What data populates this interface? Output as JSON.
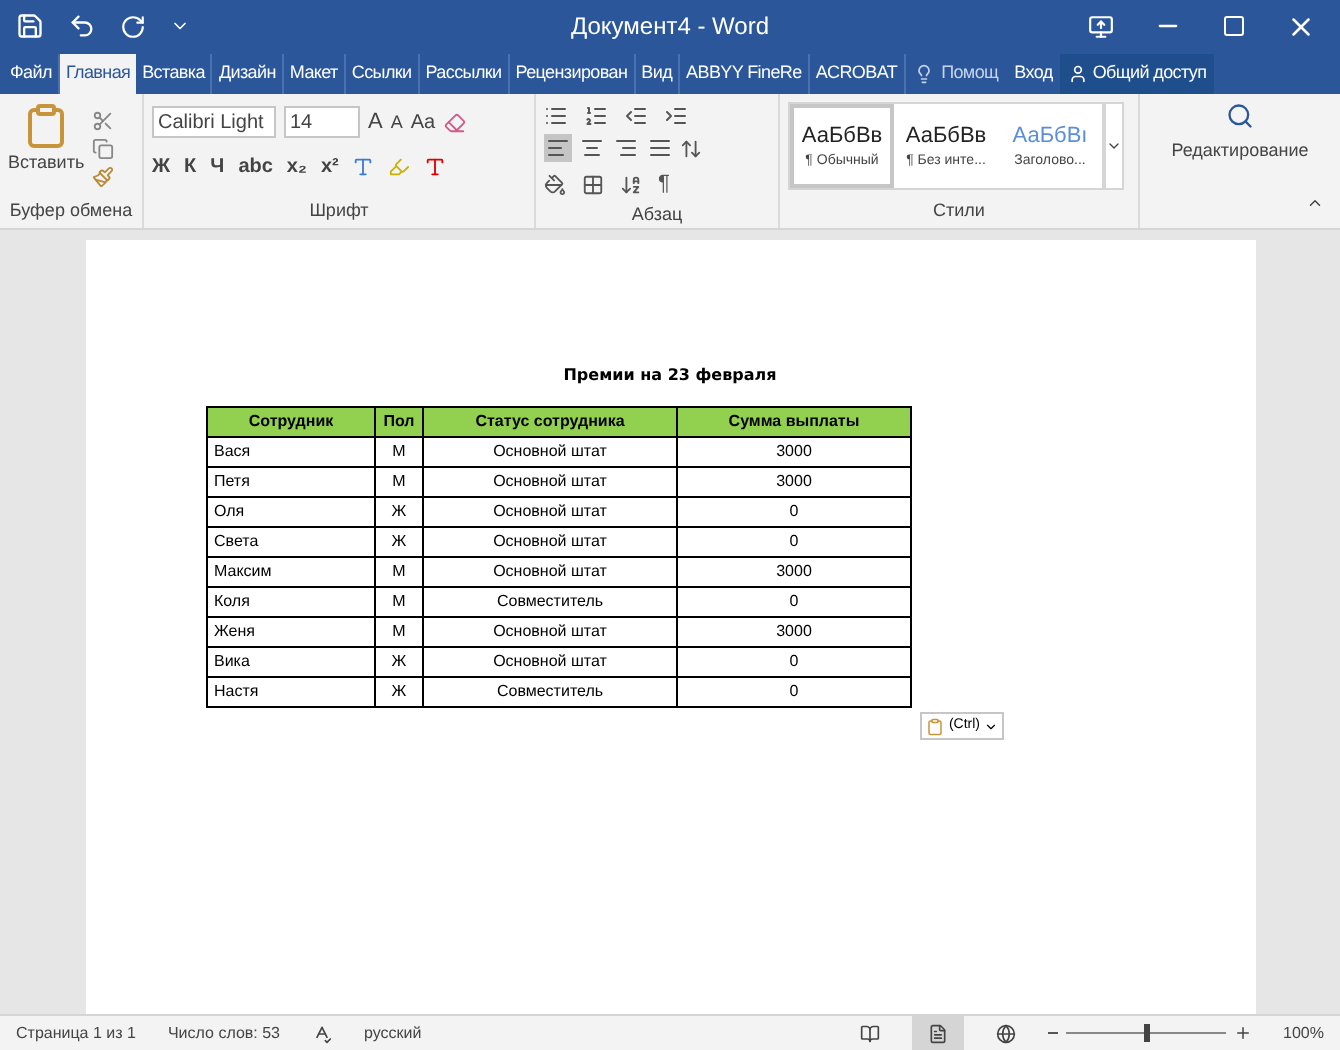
{
  "window": {
    "title": "Документ4 - Word"
  },
  "tabs": [
    {
      "label": "Файл",
      "selected": false
    },
    {
      "label": "Главная",
      "selected": true
    },
    {
      "label": "Вставка",
      "selected": false
    },
    {
      "label": "Дизайн",
      "selected": false
    },
    {
      "label": "Макет",
      "selected": false
    },
    {
      "label": "Ссылки",
      "selected": false
    },
    {
      "label": "Рассылки",
      "selected": false
    },
    {
      "label": "Рецензирован",
      "selected": false
    },
    {
      "label": "Вид",
      "selected": false
    },
    {
      "label": "ABBYY FineRe",
      "selected": false
    },
    {
      "label": "ACROBAT",
      "selected": false
    }
  ],
  "tell_me": "Помощ",
  "sign_in": "Вход",
  "share": "Общий доступ",
  "ribbon": {
    "clipboard": {
      "paste": "Вставить",
      "label": "Буфер обмена"
    },
    "font": {
      "name": "Calibri Light",
      "size": "14",
      "grow": "A",
      "shrink": "A",
      "case": "Aa",
      "styles": [
        "Ж",
        "К",
        "Ч",
        "abc",
        "x₂",
        "x²"
      ],
      "label": "Шрифт"
    },
    "paragraph": {
      "label": "Абзац",
      "align": [
        {
          "kind": "left",
          "selected": true
        },
        {
          "kind": "center",
          "selected": false
        },
        {
          "kind": "right",
          "selected": false
        },
        {
          "kind": "justify",
          "selected": false
        }
      ],
      "pilcrow": "¶"
    },
    "styles": {
      "label": "Стили",
      "items": [
        {
          "sample": "АаБбВв",
          "name": "¶ Обычный",
          "selected": true,
          "kind": "normal"
        },
        {
          "sample": "АаБбВв",
          "name": "¶ Без инте...",
          "selected": false,
          "kind": "normal"
        },
        {
          "sample": "АаБбВı",
          "name": "Заголово...",
          "selected": false,
          "kind": "heading"
        }
      ]
    },
    "editing": {
      "label": "Редактирование"
    }
  },
  "document": {
    "title": "Премии на 23 февраля",
    "table": {
      "columns": [
        "Сотрудник",
        "Пол",
        "Статус сотрудника",
        "Сумма выплаты"
      ],
      "rows": [
        [
          "Вася",
          "М",
          "Основной штат",
          "3000"
        ],
        [
          "Петя",
          "М",
          "Основной штат",
          "3000"
        ],
        [
          "Оля",
          "Ж",
          "Основной штат",
          "0"
        ],
        [
          "Света",
          "Ж",
          "Основной штат",
          "0"
        ],
        [
          "Максим",
          "М",
          "Основной штат",
          "3000"
        ],
        [
          "Коля",
          "М",
          "Совместитель",
          "0"
        ],
        [
          "Женя",
          "М",
          "Основной штат",
          "3000"
        ],
        [
          "Вика",
          "Ж",
          "Основной штат",
          "0"
        ],
        [
          "Настя",
          "Ж",
          "Совместитель",
          "0"
        ]
      ]
    },
    "paste_options": "(Ctrl)"
  },
  "status_bar": {
    "page": "Страница 1 из 1",
    "words": "Число слов: 53",
    "language": "русский",
    "zoom": {
      "level": 0.5,
      "reading": "100%"
    }
  }
}
